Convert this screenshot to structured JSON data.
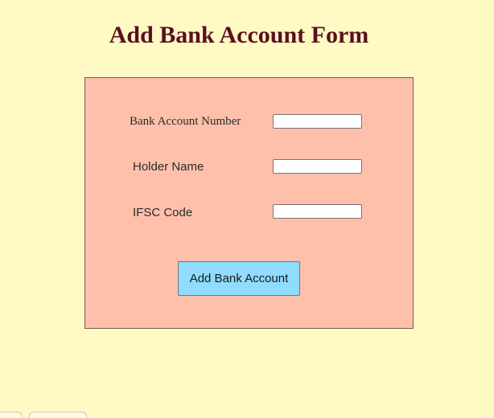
{
  "page": {
    "title": "Add Bank Account Form",
    "colors": {
      "background": "#fff9c4",
      "title": "#5a0f1e",
      "panel": "#ffc0ab",
      "button": "#8fdcff"
    }
  },
  "form": {
    "account_number": {
      "label": "Bank Account Number",
      "value": ""
    },
    "holder_name": {
      "label": "Holder Name",
      "value": ""
    },
    "ifsc_code": {
      "label": "IFSC Code",
      "value": ""
    },
    "submit_label": "Add Bank Account"
  }
}
